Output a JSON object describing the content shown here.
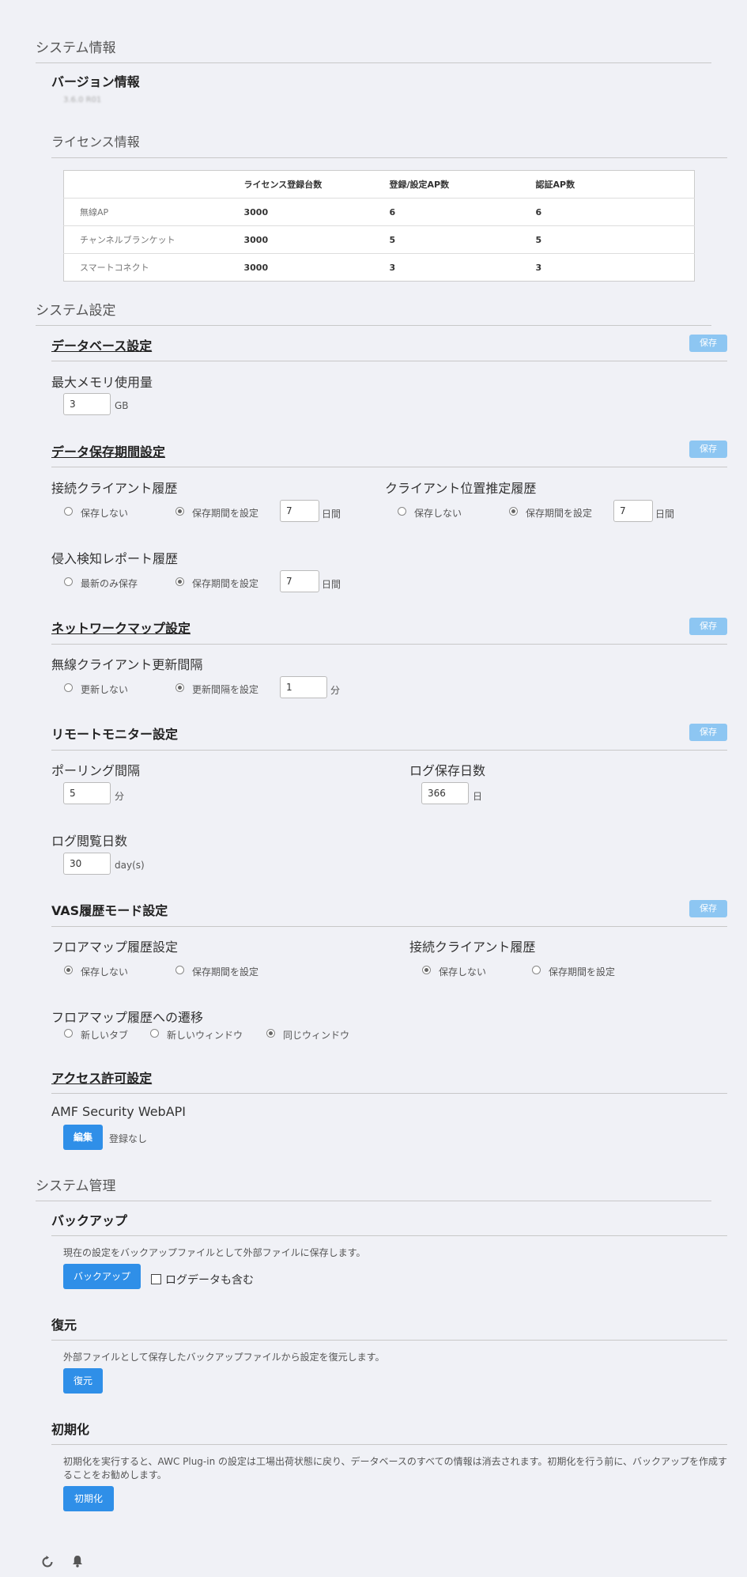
{
  "system_info": {
    "title": "システム情報",
    "version_title": "バージョン情報",
    "version_value": "3.6.0 R01",
    "license_title": "ライセンス情報",
    "license_table": {
      "headers": [
        "",
        "ライセンス登録台数",
        "登録/設定AP数",
        "認証AP数"
      ],
      "rows": [
        [
          "無線AP",
          "3000",
          "6",
          "6"
        ],
        [
          "チャンネルブランケット",
          "3000",
          "5",
          "5"
        ],
        [
          "スマートコネクト",
          "3000",
          "3",
          "3"
        ]
      ]
    }
  },
  "system_settings": {
    "title": "システム設定",
    "save_label": "保存",
    "database": {
      "title": "データベース設定",
      "max_memory_label": "最大メモリ使用量",
      "max_memory_value": "3",
      "max_memory_unit": "GB"
    },
    "retention": {
      "title": "データ保存期間設定",
      "client_history": {
        "label": "接続クライアント履歴",
        "opt_none": "保存しない",
        "opt_set": "保存期間を設定",
        "value": "7",
        "unit": "日間"
      },
      "position_history": {
        "label": "クライアント位置推定履歴",
        "opt_none": "保存しない",
        "opt_set": "保存期間を設定",
        "value": "7",
        "unit": "日間"
      },
      "intrusion_history": {
        "label": "侵入検知レポート履歴",
        "opt_latest": "最新のみ保存",
        "opt_set": "保存期間を設定",
        "value": "7",
        "unit": "日間"
      }
    },
    "network_map": {
      "title": "ネットワークマップ設定",
      "interval_label": "無線クライアント更新間隔",
      "opt_none": "更新しない",
      "opt_set": "更新間隔を設定",
      "value": "1",
      "unit": "分"
    },
    "remote_monitor": {
      "title": "リモートモニター設定",
      "polling_label": "ポーリング間隔",
      "polling_value": "5",
      "polling_unit": "分",
      "log_keep_label": "ログ保存日数",
      "log_keep_value": "366",
      "log_keep_unit": "日",
      "log_view_label": "ログ閲覧日数",
      "log_view_value": "30",
      "log_view_unit": "day(s)"
    },
    "vas": {
      "title": "VAS履歴モード設定",
      "floor_label": "フロアマップ履歴設定",
      "client_label": "接続クライアント履歴",
      "opt_none": "保存しない",
      "opt_set": "保存期間を設定",
      "transition_label": "フロアマップ履歴への遷移",
      "opt_new_tab": "新しいタブ",
      "opt_new_window": "新しいウィンドウ",
      "opt_same_window": "同じウィンドウ"
    },
    "access": {
      "title": "アクセス許可設定",
      "api_label": "AMF Security WebAPI",
      "edit_label": "編集",
      "status": "登録なし"
    }
  },
  "system_admin": {
    "title": "システム管理",
    "backup": {
      "title": "バックアップ",
      "desc": "現在の設定をバックアップファイルとして外部ファイルに保存します。",
      "button": "バックアップ",
      "include_logs": "ログデータも含む"
    },
    "restore": {
      "title": "復元",
      "desc": "外部ファイルとして保存したバックアップファイルから設定を復元します。",
      "button": "復元"
    },
    "init": {
      "title": "初期化",
      "desc_line1": "初期化を実行すると、AWC Plug-in の設定は工場出荷状態に戻り、データベースのすべての情報は消去されます。初期化を行う前に、バックアップを作成す",
      "desc_line2": "ることをお勧めします。",
      "button": "初期化"
    }
  },
  "footer": {
    "icons": [
      "refresh-icon",
      "bell-icon"
    ]
  }
}
